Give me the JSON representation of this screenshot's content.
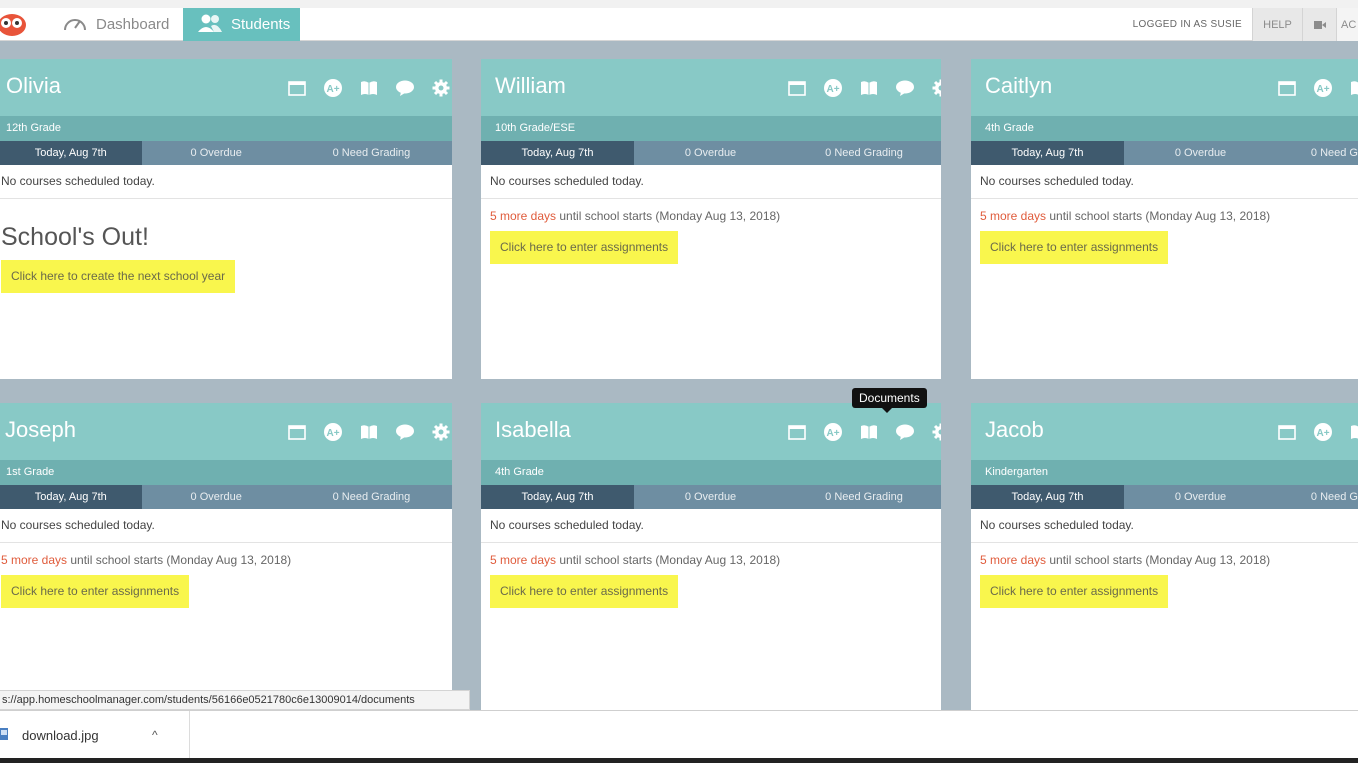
{
  "nav": {
    "dashboard_label": "Dashboard",
    "students_label": "Students",
    "logged_in": "LOGGED IN AS SUSIE",
    "help_label": "HELP",
    "acct_label": "AC"
  },
  "cards": [
    {
      "name": "Olivia",
      "grade": "12th Grade",
      "today": "Today, Aug 7th",
      "overdue": "0 Overdue",
      "grading": "0 Need Grading",
      "no_courses": "No courses scheduled today.",
      "schools_out": "School's Out!",
      "button": "Click here to create the next school year"
    },
    {
      "name": "William",
      "grade": "10th Grade/ESE",
      "today": "Today, Aug 7th",
      "overdue": "0 Overdue",
      "grading": "0 Need Grading",
      "no_courses": "No courses scheduled today.",
      "days_red": "5 more days",
      "days_rest": " until school starts (Monday Aug 13, 2018)",
      "button": "Click here to enter assignments"
    },
    {
      "name": "Caitlyn",
      "grade": "4th Grade",
      "today": "Today, Aug 7th",
      "overdue": "0 Overdue",
      "grading": "0 Need G",
      "no_courses": "No courses scheduled today.",
      "days_red": "5 more days",
      "days_rest": " until school starts (Monday Aug 13, 2018)",
      "button": "Click here to enter assignments"
    },
    {
      "name": "Joseph",
      "grade": "1st Grade",
      "today": "Today, Aug 7th",
      "overdue": "0 Overdue",
      "grading": "0 Need Grading",
      "no_courses": "No courses scheduled today.",
      "days_red": "5 more days",
      "days_rest": " until school starts (Monday Aug 13, 2018)",
      "button": "Click here to enter assignments"
    },
    {
      "name": "Isabella",
      "grade": "4th Grade",
      "today": "Today, Aug 7th",
      "overdue": "0 Overdue",
      "grading": "0 Need Grading",
      "no_courses": "No courses scheduled today.",
      "days_red": "5 more days",
      "days_rest": " until school starts (Monday Aug 13, 2018)",
      "button": "Click here to enter assignments"
    },
    {
      "name": "Jacob",
      "grade": "Kindergarten",
      "today": "Today, Aug 7th",
      "overdue": "0 Overdue",
      "grading": "0 Need G",
      "no_courses": "No courses scheduled today.",
      "days_red": "5 more days",
      "days_rest": " until school starts (Monday Aug 13, 2018)",
      "button": "Click here to enter assignments"
    }
  ],
  "tooltip": "Documents",
  "status_url": "s://app.homeschoolmanager.com/students/56166e0521780c6e13009014/documents",
  "download": {
    "filename": "download.jpg",
    "caret": "^"
  },
  "colors": {
    "accent": "#68c0be",
    "card_head": "#88c9c6",
    "highlight": "#f9f64d",
    "days_red": "#e05c3c"
  },
  "icons": [
    "calendar-icon",
    "grades-icon",
    "book-icon",
    "documents-icon",
    "gear-icon"
  ]
}
